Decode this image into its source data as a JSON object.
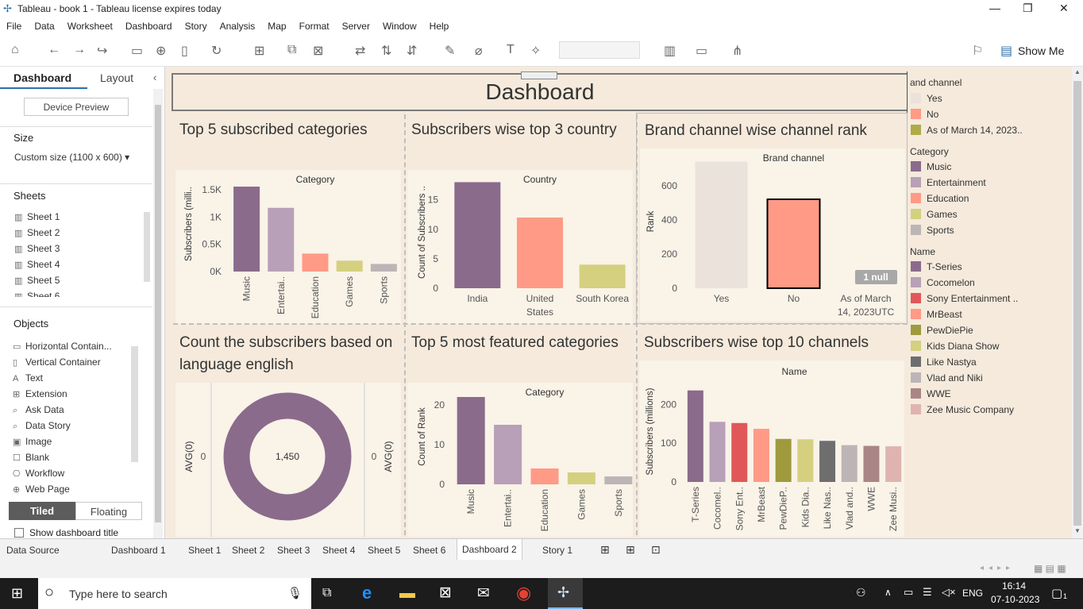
{
  "window": {
    "title": "Tableau - book 1 - Tableau license expires today"
  },
  "menu": [
    "File",
    "Data",
    "Worksheet",
    "Dashboard",
    "Story",
    "Analysis",
    "Map",
    "Format",
    "Server",
    "Window",
    "Help"
  ],
  "toolbar": {
    "show_me": "Show Me"
  },
  "left": {
    "tab_dashboard": "Dashboard",
    "tab_layout": "Layout",
    "device_preview": "Device Preview",
    "size_title": "Size",
    "size_value": "Custom size (1100 x 600)",
    "sheets_title": "Sheets",
    "sheets": [
      "Sheet 1",
      "Sheet 2",
      "Sheet 3",
      "Sheet 4",
      "Sheet 5",
      "Sheet 6"
    ],
    "objects_title": "Objects",
    "objects": [
      "Horizontal Contain...",
      "Vertical Container",
      "Text",
      "Extension",
      "Ask Data",
      "Data Story",
      "Image",
      "Blank",
      "Workflow",
      "Web Page"
    ],
    "tiled": "Tiled",
    "floating": "Floating",
    "show_title": "Show dashboard title"
  },
  "dashboard": {
    "title": "Dashboard",
    "p1": {
      "title": "Top  5   subscribed categories",
      "hdr": "Category",
      "yaxis": "Subscribers (milli..",
      "ticks": [
        "1.5K",
        "1K",
        "0.5K",
        "0K"
      ]
    },
    "p2": {
      "title": "Subscribers wise top 3 country",
      "hdr": "Country",
      "yaxis": "Count of Subscribers ..",
      "ticks": [
        "15",
        "10",
        "5",
        "0"
      ]
    },
    "p3": {
      "title": "Brand channel wise channel rank",
      "hdr": "Brand channel",
      "yaxis": "Rank",
      "ticks": [
        "600",
        "400",
        "200",
        "0"
      ],
      "null_badge": "1 null"
    },
    "p4": {
      "title": "Count the subscribers based on language english",
      "left_axis": "AVG(0)",
      "right_axis": "AVG(0)",
      "zero_l": "0",
      "zero_r": "0",
      "center_value": "1,450"
    },
    "p5": {
      "title": "Top 5 most featured categories",
      "hdr": "Category",
      "yaxis": "Count of Rank",
      "ticks": [
        "20",
        "10",
        "0"
      ]
    },
    "p6": {
      "title": "Subscribers wise top 10 channels",
      "hdr": "Name",
      "yaxis": "Subscribers (millions)",
      "ticks": [
        "200",
        "100",
        "0"
      ]
    }
  },
  "chart_data": [
    {
      "type": "bar",
      "title": "Top  5   subscribed categories",
      "xlabel": "Category",
      "ylabel": "Subscribers (milli..",
      "categories": [
        "Music",
        "Entertai..",
        "Education",
        "Games",
        "Sports"
      ],
      "values": [
        1560,
        1170,
        330,
        200,
        140
      ],
      "ylim": [
        0,
        1750
      ],
      "colors": [
        "#8b6b8c",
        "#b8a0b8",
        "#ff9a86",
        "#d4d080",
        "#bdb5b5"
      ]
    },
    {
      "type": "bar",
      "title": "Subscribers wise top 3 country",
      "xlabel": "Country",
      "ylabel": "Count of Subscribers ..",
      "categories": [
        "India",
        "United States",
        "South Korea"
      ],
      "values": [
        18,
        12,
        4
      ],
      "ylim": [
        0,
        19
      ],
      "colors": [
        "#8b6b8c",
        "#ff9a86",
        "#d4d080"
      ]
    },
    {
      "type": "bar",
      "title": "Brand channel wise channel rank",
      "xlabel": "Brand channel",
      "ylabel": "Rank",
      "categories": [
        "Yes",
        "No",
        "As of March 14, 2023UTC"
      ],
      "values": [
        740,
        520,
        null
      ],
      "ylim": [
        0,
        780
      ],
      "colors": [
        "#ebe2dc",
        "#ff9a86",
        "#b0aa4a"
      ]
    },
    {
      "type": "pie",
      "title": "Count the subscribers based on language english",
      "values": [
        1450
      ]
    },
    {
      "type": "bar",
      "title": "Top 5 most featured categories",
      "xlabel": "Category",
      "ylabel": "Count of Rank",
      "categories": [
        "Music",
        "Entertai..",
        "Education",
        "Games",
        "Sports"
      ],
      "values": [
        22,
        15,
        4,
        3,
        2
      ],
      "ylim": [
        0,
        24
      ],
      "colors": [
        "#8b6b8c",
        "#b8a0b8",
        "#ff9a86",
        "#d4d080",
        "#bdb5b5"
      ]
    },
    {
      "type": "bar",
      "title": "Subscribers wise top 10 channels",
      "xlabel": "Name",
      "ylabel": "Subscribers (millions)",
      "categories": [
        "T-Series",
        "Cocomel..",
        "Sony Ent..",
        "MrBeast",
        "PewDieP..",
        "Kids Dia..",
        "Like Nas..",
        "Vlad and..",
        "WWE",
        "Zee Musi.."
      ],
      "values": [
        236,
        155,
        152,
        137,
        111,
        110,
        106,
        95,
        93,
        92
      ],
      "ylim": [
        0,
        260
      ],
      "colors": [
        "#8b6b8c",
        "#b8a0b8",
        "#e15759",
        "#ff9a86",
        "#9f9a3e",
        "#d4d080",
        "#6e6e6e",
        "#bdb5b5",
        "#a98685",
        "#dfb4b0"
      ]
    }
  ],
  "legend": {
    "brand_title": "and channel",
    "brand": [
      {
        "label": "Yes",
        "color": "#ebe2dc"
      },
      {
        "label": "No",
        "color": "#ff9a86"
      },
      {
        "label": "As of March 14, 2023..",
        "color": "#b0aa4a"
      }
    ],
    "category_title": "Category",
    "category": [
      {
        "label": "Music",
        "color": "#8b6b8c"
      },
      {
        "label": "Entertainment",
        "color": "#b8a0b8"
      },
      {
        "label": "Education",
        "color": "#ff9a86"
      },
      {
        "label": "Games",
        "color": "#d4d080"
      },
      {
        "label": "Sports",
        "color": "#bdb5b5"
      }
    ],
    "name_title": "Name",
    "name": [
      {
        "label": "T-Series",
        "color": "#8b6b8c"
      },
      {
        "label": "Cocomelon",
        "color": "#b8a0b8"
      },
      {
        "label": "Sony Entertainment ..",
        "color": "#e15759"
      },
      {
        "label": "MrBeast",
        "color": "#ff9a86"
      },
      {
        "label": "PewDiePie",
        "color": "#9f9a3e"
      },
      {
        "label": "Kids Diana Show",
        "color": "#d4d080"
      },
      {
        "label": "Like Nastya",
        "color": "#6e6e6e"
      },
      {
        "label": "Vlad and Niki",
        "color": "#bdb5b5"
      },
      {
        "label": "WWE",
        "color": "#a98685"
      },
      {
        "label": "Zee Music Company",
        "color": "#dfb4b0"
      }
    ]
  },
  "tabs": [
    "Data Source",
    "Dashboard 1",
    "Sheet 1",
    "Sheet 2",
    "Sheet 3",
    "Sheet 4",
    "Sheet 5",
    "Sheet 6",
    "Dashboard 2",
    "Story 1"
  ],
  "taskbar": {
    "search": "Type here to search",
    "lang": "ENG",
    "time": "16:14",
    "date": "07-10-2023",
    "notif": "1"
  }
}
